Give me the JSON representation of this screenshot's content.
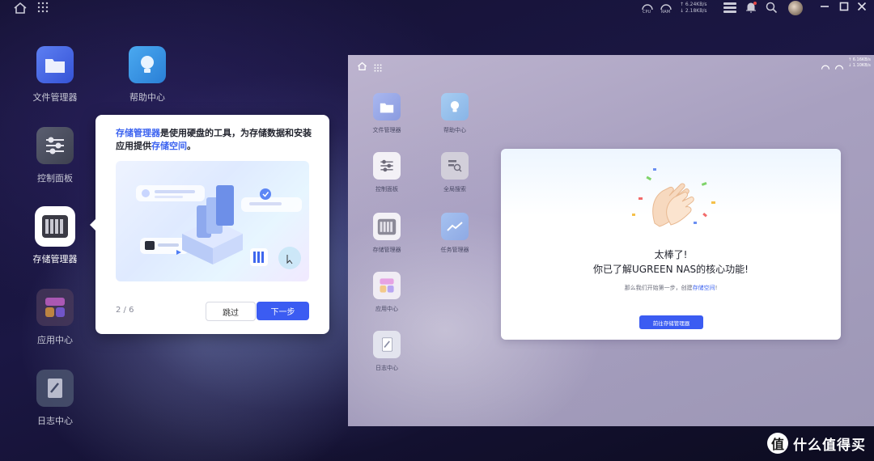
{
  "topbar": {
    "cpu_label": "CPU",
    "ram_label": "RAM",
    "net_up": "↑ 6.24KB/s",
    "net_down": "↓ 2.18KB/s"
  },
  "desktop": {
    "apps": [
      {
        "label": "文件管理器"
      },
      {
        "label": "帮助中心"
      },
      {
        "label": "控制面板"
      },
      {
        "label": "存储管理器"
      },
      {
        "label": "应用中心"
      },
      {
        "label": "日志中心"
      }
    ]
  },
  "tooltip": {
    "text_hl1": "存储管理器",
    "text_mid": "是使用硬盘的工具，为存储数据和安装应用提供",
    "text_hl2": "存储空间",
    "text_end": "。",
    "step": "2 / 6",
    "skip_label": "跳过",
    "next_label": "下一步"
  },
  "overlay_window": {
    "net_up": "↑ 6.16KB/s",
    "net_down": "↓ 1.10KB/s",
    "apps": [
      {
        "label": "文件管理器"
      },
      {
        "label": "帮助中心"
      },
      {
        "label": "控制面板"
      },
      {
        "label": "全局搜索"
      },
      {
        "label": "存储管理器"
      },
      {
        "label": "任务管理器"
      },
      {
        "label": "应用中心"
      },
      {
        "label": "日志中心"
      }
    ],
    "dialog": {
      "title1": "太棒了!",
      "title2": "你已了解UGREEN NAS的核心功能!",
      "sub_pre": "那么我们开始第一步，创建",
      "sub_link": "存储空间",
      "sub_post": "!",
      "button": "前往存储管理器"
    }
  },
  "watermark": {
    "logo": "值",
    "text": "什么值得买"
  }
}
